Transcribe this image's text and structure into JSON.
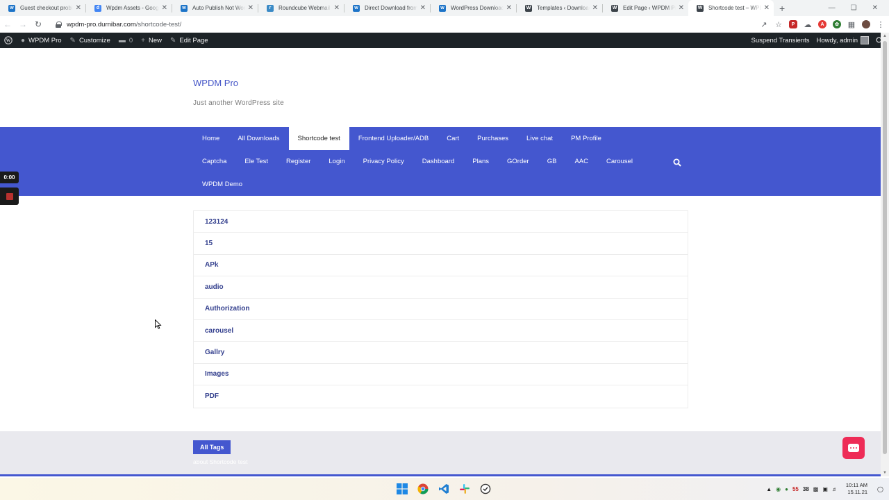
{
  "browser": {
    "tabs": [
      {
        "title": "Guest checkout problem",
        "favicon_color": "#1d74c8",
        "favicon": "w"
      },
      {
        "title": "Wpdm Assets - Google Docs",
        "favicon_color": "#4285f4",
        "favicon": "d"
      },
      {
        "title": "Auto Publish Not Working",
        "favicon_color": "#1d74c8",
        "favicon": "w"
      },
      {
        "title": "Roundcube Webmail",
        "favicon_color": "#3a8ac6",
        "favicon": "r"
      },
      {
        "title": "Direct Download from",
        "favicon_color": "#1d74c8",
        "favicon": "w"
      },
      {
        "title": "WordPress Download",
        "favicon_color": "#1d74c8",
        "favicon": "w"
      },
      {
        "title": "Templates ‹ Download",
        "favicon_color": "#3c434a",
        "favicon": "W"
      },
      {
        "title": "Edit Page ‹ WPDM Pro",
        "favicon_color": "#3c434a",
        "favicon": "W"
      },
      {
        "title": "Shortcode test – WPDM",
        "favicon_color": "#3c434a",
        "favicon": "W",
        "active": true
      }
    ],
    "url_host": "wpdm-pro.durnibar.com",
    "url_path": "/shortcode-test/"
  },
  "adminbar": {
    "site_name": "WPDM Pro",
    "customize": "Customize",
    "comments": "0",
    "new": "New",
    "edit_page": "Edit Page",
    "suspend": "Suspend Transients",
    "howdy": "Howdy, admin"
  },
  "site": {
    "title": "WPDM Pro",
    "description": "Just another WordPress site"
  },
  "menu": {
    "row1": [
      "Home",
      "All Downloads",
      "Shortcode test",
      "Frontend Uploader/ADB",
      "Cart",
      "Purchases",
      "Live chat",
      "PM Profile"
    ],
    "row2": [
      "Captcha",
      "Ele Test",
      "Register",
      "Login",
      "Privacy Policy",
      "Dashboard",
      "Plans",
      "GOrder",
      "GB",
      "AAC",
      "Carousel"
    ],
    "row3": [
      "WPDM Demo"
    ],
    "current": "Shortcode test"
  },
  "tags": [
    "123124",
    "15",
    "APk",
    "audio",
    "Authorization",
    "carousel",
    "Gallry",
    "Images",
    "PDF"
  ],
  "footer": {
    "all_tags_label": "All Tags",
    "about_text": "about Shortcode test"
  },
  "recorder": {
    "time": "0:00"
  },
  "taskbar": {
    "tray_num1": "55",
    "tray_num2": "38",
    "time": "10:11 AM",
    "date": "15.11.21"
  },
  "colors": {
    "nav_bg": "#4457cf",
    "tag_link": "#34408e",
    "chat_button": "#ee2c57"
  }
}
